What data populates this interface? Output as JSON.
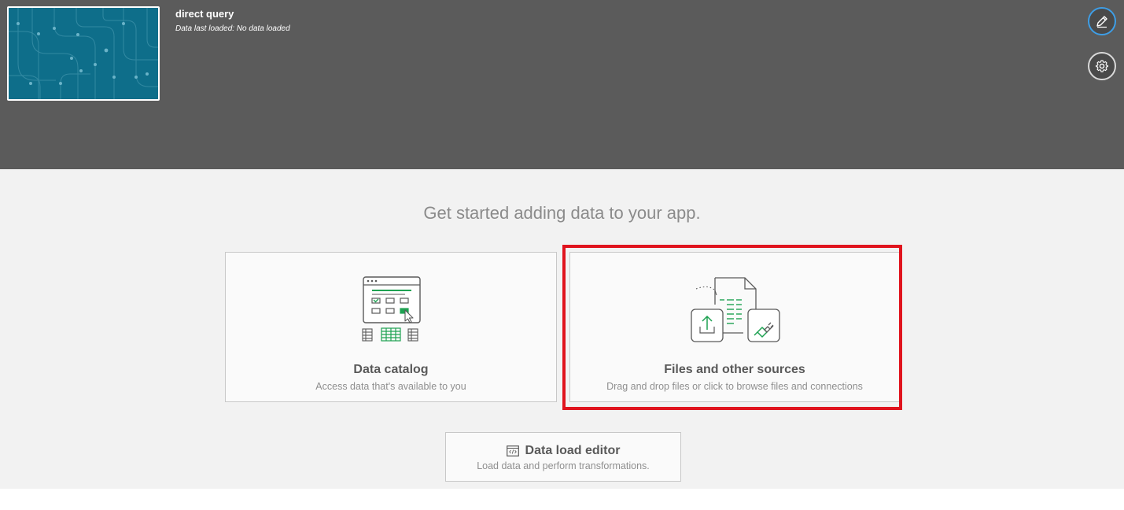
{
  "app": {
    "title": "direct query",
    "subtitle": "Data last loaded: No data loaded"
  },
  "header": {
    "edit_icon": "pencil-icon",
    "settings_icon": "gear-icon",
    "accent_color": "#3e9ee6",
    "background_color": "#5b5b5b",
    "thumbnail_color": "#0e6e8a"
  },
  "main": {
    "headline": "Get started adding data to your app.",
    "cards": [
      {
        "title": "Data catalog",
        "description": "Access data that's available to you",
        "icon": "data-catalog-icon"
      },
      {
        "title": "Files and other sources",
        "description": "Drag and drop files or click to browse files and connections",
        "icon": "files-sources-icon",
        "highlighted": true,
        "highlight_color": "#e0141e"
      }
    ],
    "editor": {
      "title": "Data load editor",
      "description": "Load data and perform transformations.",
      "icon": "script-editor-icon"
    }
  }
}
